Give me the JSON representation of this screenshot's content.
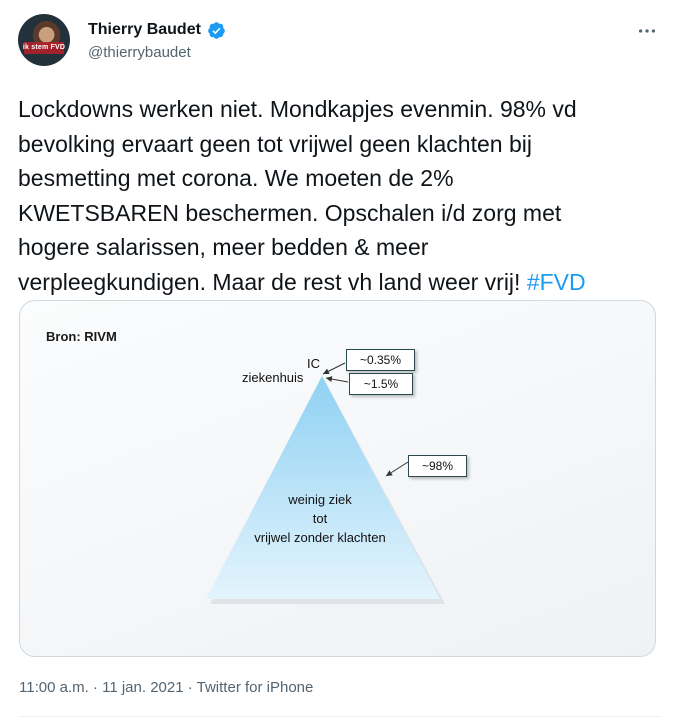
{
  "author": {
    "name": "Thierry Baudet",
    "handle": "@thierrybaudet",
    "avatar_caption": "ik stem FVD"
  },
  "tweet": {
    "text": "Lockdowns werken niet. Mondkapjes evenmin. 98% vd\nbevolking ervaart geen tot vrijwel geen klachten bij\nbesmetting met corona. We moeten de 2%\nKWETSBAREN beschermen. Opschalen i/d zorg met\nhogere salarissen, meer bedden & meer\nverpleegkundigen. Maar de rest vh land weer vrij! ",
    "hashtag": "#FVD"
  },
  "media": {
    "source_label": "Bron: RIVM",
    "label_ic": "IC",
    "label_hospital": "ziekenhuis",
    "callout_ic": "~0.35%",
    "callout_hospital": "~1.5%",
    "callout_mild": "~98%",
    "inside_line1": "weinig ziek",
    "inside_line2": "tot",
    "inside_line3": "vrijwel zonder klachten"
  },
  "footer": {
    "time": "11:00 a.m.",
    "separator": " · ",
    "date": "11 jan. 2021",
    "client": "Twitter for iPhone"
  },
  "colors": {
    "hashtag": "#1d9bf0",
    "verified": "#1d9bf0",
    "pyramid_top": "#8fd1f3",
    "pyramid_bottom": "#e4f4fd"
  }
}
